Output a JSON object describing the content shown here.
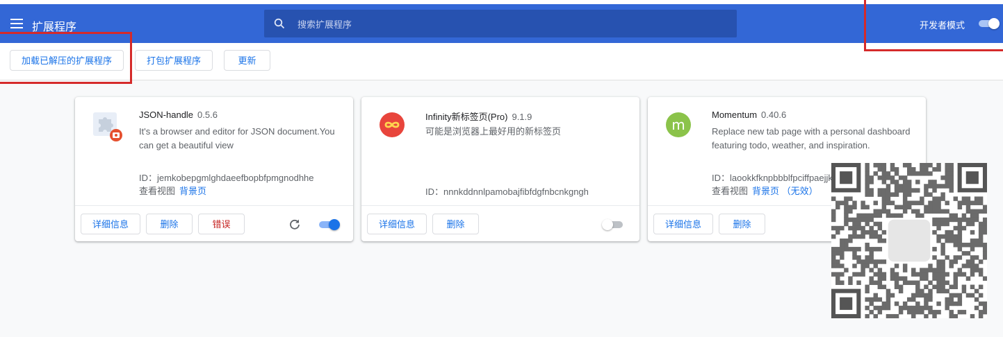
{
  "header": {
    "title": "扩展程序",
    "search_placeholder": "搜索扩展程序",
    "devmode_label": "开发者模式",
    "devmode_on": true
  },
  "toolbar": {
    "load_unpacked": "加载已解压的扩展程序",
    "pack": "打包扩展程序",
    "update": "更新"
  },
  "extensions": [
    {
      "name": "JSON-handle",
      "version": "0.5.6",
      "description": "It's a browser and editor for JSON document.You can get a beautiful view",
      "id": "ID：jemkobepgmlghdaeefbopbfpmgnodhhe",
      "views_label": "查看视图",
      "views_link": "背景页",
      "details": "详细信息",
      "remove": "删除",
      "errors": "错误",
      "enabled": true,
      "icon": "puzzle-icon"
    },
    {
      "name": "Infinity新标签页(Pro)",
      "version": "9.1.9",
      "description": "可能是浏览器上最好用的新标签页",
      "id": "ID：nnnkddnnlpamobajfibfdgfnbcnkgngh",
      "details": "详细信息",
      "remove": "删除",
      "enabled": false,
      "icon": "infinity-icon",
      "icon_color": "#e8453c"
    },
    {
      "name": "Momentum",
      "version": "0.40.6",
      "description": "Replace new tab page with a personal dashboard featuring todo, weather, and inspiration.",
      "id": "ID：laookkfknpbbblfpciffpaejjkokdgca",
      "views_label": "查看视图",
      "views_link": "背景页 （无效）",
      "details": "详细信息",
      "remove": "删除",
      "enabled": true,
      "icon": "momentum-icon",
      "icon_letter": "m",
      "icon_color": "#8bc34a"
    }
  ],
  "colors": {
    "header": "#3367d6",
    "accent": "#1a73e8",
    "annotation": "#d52a2a"
  }
}
